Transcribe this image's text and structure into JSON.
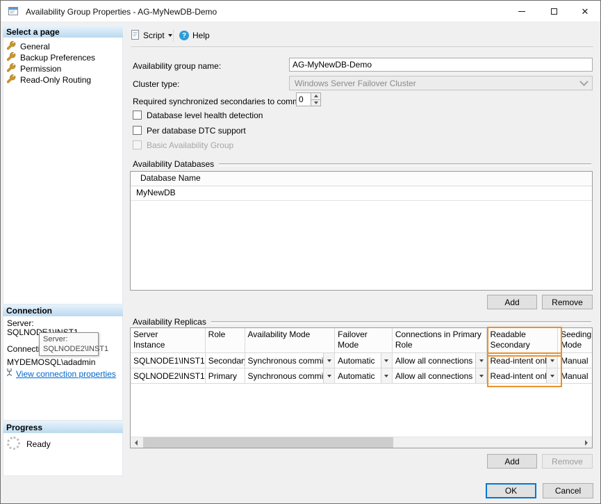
{
  "window": {
    "title": "Availability Group Properties - AG-MyNewDB-Demo",
    "close_glyph": "✕"
  },
  "sidebar": {
    "select_page_header": "Select a page",
    "pages": [
      {
        "label": "General"
      },
      {
        "label": "Backup Preferences"
      },
      {
        "label": "Permission"
      },
      {
        "label": "Read-Only Routing"
      }
    ],
    "connection": {
      "header": "Connection",
      "server_label": "Server:",
      "server_value": "SQLNODE1\\INST1",
      "connection_label": "Connection:",
      "connection_value": "MYDEMOSQL\\adadmin",
      "view_link": "View connection properties"
    },
    "progress": {
      "header": "Progress",
      "status": "Ready"
    }
  },
  "tooltip": {
    "line1": "Server:",
    "line2": "SQLNODE2\\INST1"
  },
  "toolbar": {
    "script_label": "Script",
    "help_label": "Help",
    "help_glyph": "?"
  },
  "form": {
    "ag_name_label": "Availability group name:",
    "ag_name_value": "AG-MyNewDB-Demo",
    "cluster_type_label": "Cluster type:",
    "cluster_type_value": "Windows Server Failover Cluster",
    "required_secondaries_label": "Required synchronized secondaries to commit:",
    "required_secondaries_value": "0",
    "checkbox_db_health_label": "Database level health detection",
    "checkbox_dtc_label": "Per database DTC support",
    "checkbox_basic_ag_label": "Basic Availability Group"
  },
  "databases": {
    "group_label": "Availability Databases",
    "columns": [
      "Database Name"
    ],
    "rows": [
      {
        "name": "MyNewDB"
      }
    ],
    "add_label": "Add",
    "remove_label": "Remove"
  },
  "replicas": {
    "group_label": "Availability Replicas",
    "columns": [
      "Server\nInstance",
      "Role",
      "Availability Mode",
      "Failover\nMode",
      "Connections in Primary\nRole",
      "Readable\nSecondary",
      "Seeding\nMode"
    ],
    "rows": [
      {
        "server": "SQLNODE1\\INST1",
        "role": "Secondary",
        "availability_mode": "Synchronous commit",
        "failover_mode": "Automatic",
        "connections": "Allow all connections",
        "readable_secondary": "Read-intent only",
        "seeding_mode": "Manual"
      },
      {
        "server": "SQLNODE2\\INST1",
        "role": "Primary",
        "availability_mode": "Synchronous commit",
        "failover_mode": "Automatic",
        "connections": "Allow all connections",
        "readable_secondary": "Read-intent only",
        "seeding_mode": "Manual"
      }
    ],
    "add_label": "Add",
    "remove_label": "Remove"
  },
  "footer": {
    "ok_label": "OK",
    "cancel_label": "Cancel"
  },
  "colors": {
    "highlight_orange": "#E8912D",
    "ok_focus_border": "#0078D7",
    "link_blue": "#0066CC"
  }
}
